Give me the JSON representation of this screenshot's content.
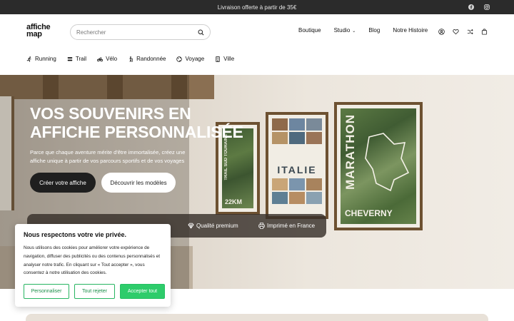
{
  "announcement": {
    "text": "Livraison offerte à partir de 35€",
    "socials": [
      "facebook-icon",
      "instagram-icon"
    ]
  },
  "header": {
    "logo_line1": "affiche",
    "logo_line2": "map",
    "search_placeholder": "Rechercher",
    "nav": [
      {
        "label": "Boutique"
      },
      {
        "label": "Studio",
        "has_dropdown": true
      },
      {
        "label": "Blog"
      },
      {
        "label": "Notre Histoire"
      }
    ],
    "icons": [
      "account-icon",
      "wishlist-icon",
      "compare-icon",
      "cart-icon"
    ]
  },
  "categories": [
    {
      "label": "Running",
      "icon": "running-icon"
    },
    {
      "label": "Trail",
      "icon": "trail-icon"
    },
    {
      "label": "Vélo",
      "icon": "bike-icon"
    },
    {
      "label": "Randonnée",
      "icon": "hiking-icon"
    },
    {
      "label": "Voyage",
      "icon": "globe-icon"
    },
    {
      "label": "Ville",
      "icon": "building-icon"
    }
  ],
  "hero": {
    "title_line1": "VOS SOUVENIRS EN",
    "title_line2": "AFFICHE PERSONNALISÉE",
    "subtitle": "Parce que chaque aventure mérite d'être immortalisée, créez une affiche unique à partir de vos parcours sportifs et de vos voyages",
    "cta_primary": "Créer votre affiche",
    "cta_secondary": "Découvrir les modèles",
    "posters": {
      "p1_text": "TRAIL SUD TOURAINE",
      "p1_km": "22KM",
      "p2_word": "ITALIE",
      "p3_word": "MARATHON",
      "p3_city": "CHEVERNY"
    },
    "features": [
      {
        "label": "Qualité premium",
        "icon": "diamond-icon"
      },
      {
        "label": "Imprimé en France",
        "icon": "printer-icon"
      }
    ]
  },
  "cookie": {
    "title": "Nous respectons votre vie privée.",
    "body": "Nous utilisons des cookies pour améliorer votre expérience de navigation, diffuser des publicités ou des contenus personnalisés et analyser notre trafic. En cliquant sur « Tout accepter », vous consentez à notre utilisation des cookies.",
    "btn_customize": "Personnaliser",
    "btn_reject": "Tout rejeter",
    "btn_accept": "Accepter tout"
  },
  "colors": {
    "announcement_bg": "#2b2b2b",
    "accent_green": "#2ecc6b",
    "dark_button": "#1f1f1f"
  }
}
